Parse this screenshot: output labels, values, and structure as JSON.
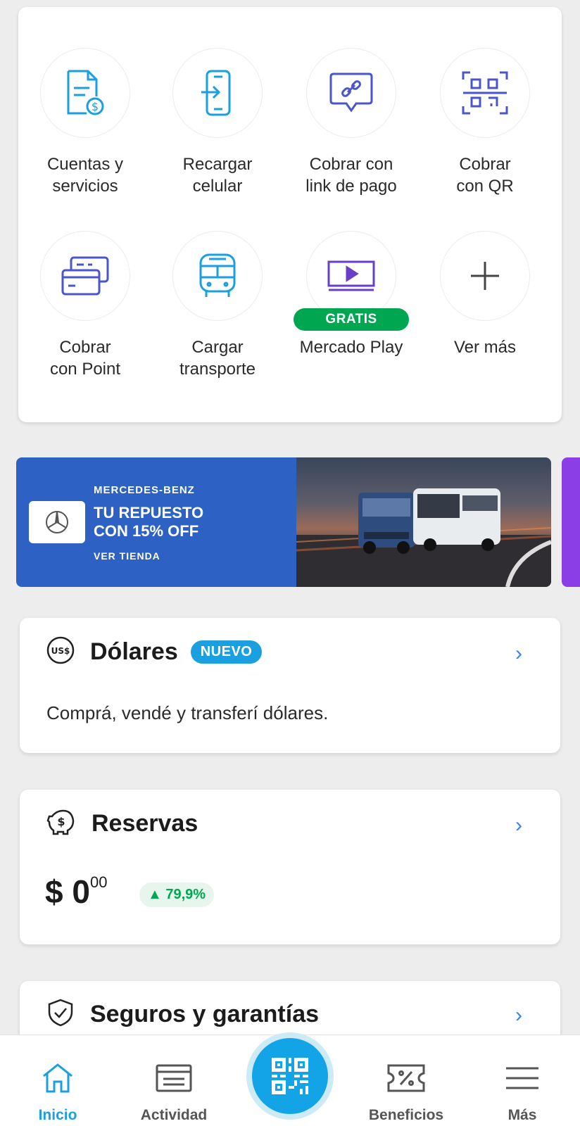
{
  "shortcuts": [
    {
      "label": "Cuentas y\nservicios",
      "icon": "bill-dollar-icon"
    },
    {
      "label": "Recargar\ncelular",
      "icon": "phone-recharge-icon"
    },
    {
      "label": "Cobrar con\nlink de pago",
      "icon": "payment-link-icon"
    },
    {
      "label": "Cobrar\ncon QR",
      "icon": "qr-scan-icon"
    },
    {
      "label": "Cobrar\ncon Point",
      "icon": "card-reader-icon"
    },
    {
      "label": "Cargar\ntransporte",
      "icon": "bus-icon"
    },
    {
      "label": "Mercado Play",
      "icon": "play-screen-icon",
      "badge": "GRATIS"
    },
    {
      "label": "Ver más",
      "icon": "plus-icon"
    }
  ],
  "banner": {
    "brand": "MERCEDES-BENZ",
    "title": "TU REPUESTO\nCON 15% OFF",
    "cta": "VER TIENDA"
  },
  "dolares": {
    "title": "Dólares",
    "badge": "NUEVO",
    "subtitle": "Comprá, vendé y transferí dólares.",
    "icon_text": "US$"
  },
  "reservas": {
    "title": "Reservas",
    "amount_main": "$ 0",
    "amount_cents": "00",
    "change": "▲ 79,9%"
  },
  "seguros": {
    "title": "Seguros y garantías"
  },
  "nav": {
    "items": [
      {
        "label": "Inicio",
        "active": true
      },
      {
        "label": "Actividad"
      },
      {
        "label": "Beneficios"
      },
      {
        "label": "Más"
      }
    ]
  },
  "colors": {
    "accent_blue": "#1a9fe0",
    "link_blue": "#3483fa",
    "green": "#00a650",
    "banner_blue": "#2d62c4",
    "icon_purple": "#4a56c9"
  }
}
